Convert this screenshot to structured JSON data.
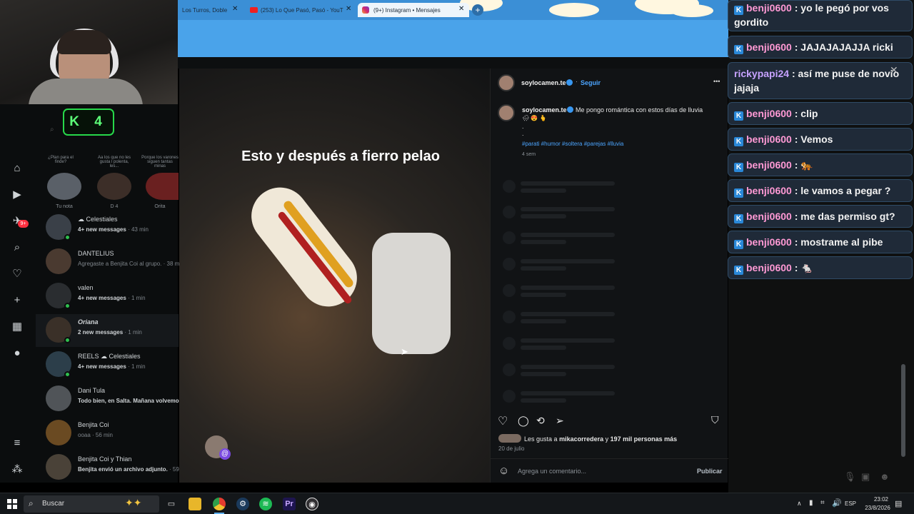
{
  "browser": {
    "tabs": [
      {
        "title": "Los Turros, Doble",
        "close": "✕"
      },
      {
        "title": "(253) Lo Que Pasó, Pasó - YouT",
        "close": "✕"
      },
      {
        "title": "(9+) Instagram • Mensajes",
        "close": "✕"
      }
    ],
    "new_tab": "+"
  },
  "webcam": {
    "badge": "K 4"
  },
  "ig_sidebar": {
    "notes": [
      {
        "note": "¿Plan para el finde?",
        "name": "Tu nota"
      },
      {
        "note": "Aa los que no les gusta l polenta, les...",
        "name": "D 4"
      },
      {
        "note": "Porque los varones siguen tantas minas",
        "name": "Orita"
      }
    ],
    "notification_badge": "9+",
    "chats": [
      {
        "name": "☁ Celestiales",
        "sub": "4+ new messages",
        "time": "· 43 min",
        "bold": true
      },
      {
        "name": "DANTELIUS",
        "sub": "Agregaste a Benjita Coi al grupo.",
        "time": "· 38 m",
        "bold": false
      },
      {
        "name": "valen",
        "sub": "4+ new messages",
        "time": "· 1 min",
        "bold": true
      },
      {
        "name": "Oriana",
        "sub": "2 new messages",
        "time": "· 1 min",
        "bold": true
      },
      {
        "name": "REELS ☁ Celestiales",
        "sub": "4+ new messages",
        "time": "· 1 min",
        "bold": true
      },
      {
        "name": "Dani Tula",
        "sub": "Todo bien, en Salta. Mañana volvemo...",
        "time": "",
        "bold": false
      },
      {
        "name": "Benjita Coi",
        "sub": "ooaa",
        "time": "· 56 min",
        "bold": false
      },
      {
        "name": "Benjita Coi y Thian",
        "sub": "Benjita envió un archivo adjunto.",
        "time": "· 59 m",
        "bold": false
      }
    ]
  },
  "post": {
    "caption_overlay": "Esto y después a fierro pelao",
    "username": "soylocamen.te",
    "follow": "Seguir",
    "more": "•••",
    "caption_text": "Me pongo romántica con estos días de lluvia",
    "caption_emojis": "🌧 😍 🫰",
    "caption_dots": ".",
    "hashtags": "#parati #humor #soltera #parejas #lluvia",
    "age": "4 sem",
    "likes_prefix": "Les gusta a",
    "likes_user": "mikacorredera",
    "likes_mid": "y",
    "likes_count": "197 mil personas más",
    "date": "20 de julio",
    "comment_placeholder": "Agrega un comentario...",
    "publish": "Publicar"
  },
  "chat": {
    "messages": [
      {
        "user": "benji0600",
        "text": "yo le pegó por vos gordito"
      },
      {
        "user": "benji0600",
        "text": "JAJAJAJAJJA ricki"
      },
      {
        "user": "rickypapi24",
        "text": "así me puse de novio jajaja"
      },
      {
        "user": "benji0600",
        "text": "clip"
      },
      {
        "user": "benji0600",
        "text": "Vemos"
      },
      {
        "user": "benji0600",
        "text": "🐅"
      },
      {
        "user": "benji0600",
        "text": "le vamos a pegar ?"
      },
      {
        "user": "benji0600",
        "text": "me das permiso gt?"
      },
      {
        "user": "benji0600",
        "text": "mostrame al pibe"
      },
      {
        "user": "benji0600",
        "text": "🐁"
      }
    ],
    "close": "✕"
  },
  "taskbar": {
    "search": "Buscar",
    "lang": "ESP",
    "time": "23:02",
    "date": "23/8/2026"
  },
  "colors": {
    "ig_link": "#4ca5ff",
    "chat_user": "#ff9ad5",
    "chat_user2": "#c6a2ff",
    "chat_border": "#2f4b66"
  }
}
